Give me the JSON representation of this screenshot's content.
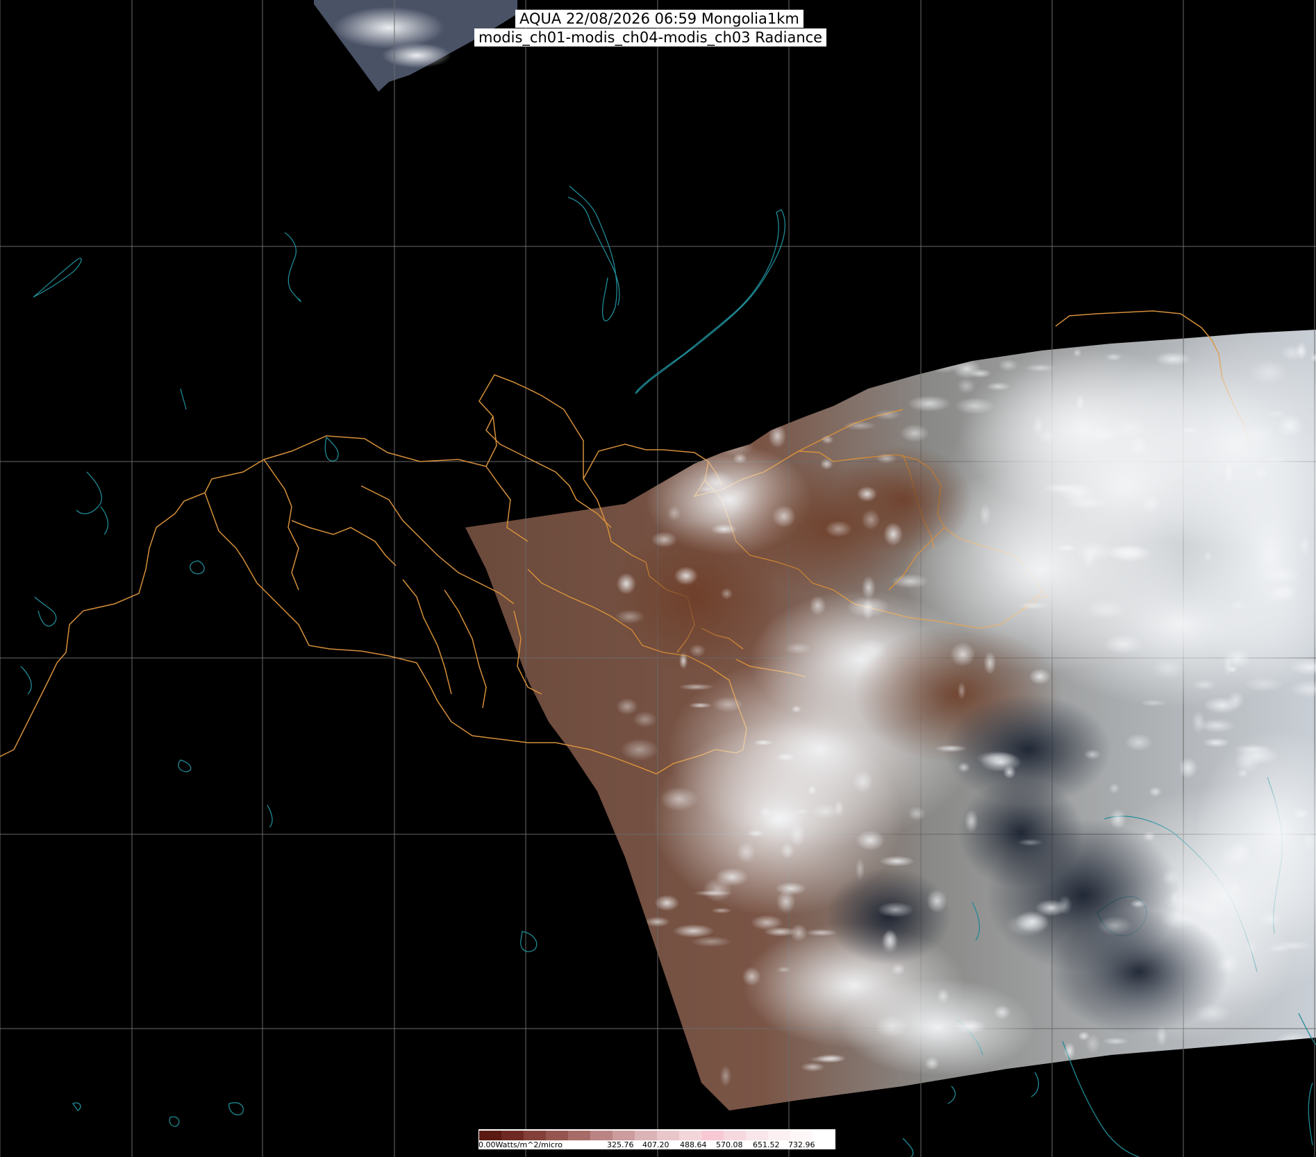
{
  "title": {
    "line1": "AQUA 22/08/2026 06:59 Mongolia1km",
    "line2": "modis_ch01-modis_ch04-modis_ch03 Radiance"
  },
  "legend": {
    "unit_label": "0.00Watts/m^2/micro",
    "ticks": [
      "325.76",
      "407.20",
      "488.64",
      "570.08",
      "651.52",
      "732.96"
    ],
    "colors": [
      "#5a1a12",
      "#6e2a22",
      "#824038",
      "#955650",
      "#a86c68",
      "#ba8484",
      "#cc9c9e",
      "#dbb4b8",
      "#e8c6ca",
      "#f3d6da",
      "#f8c9d4",
      "#f5d9df",
      "#f9e6ea",
      "#fcf0f2",
      "#fef7f8",
      "#ffffff"
    ]
  },
  "map": {
    "coastline_color": "#1f8a96",
    "border_color": "#d6903a",
    "grid_color": "#6a6a6a",
    "background": "#000000"
  }
}
